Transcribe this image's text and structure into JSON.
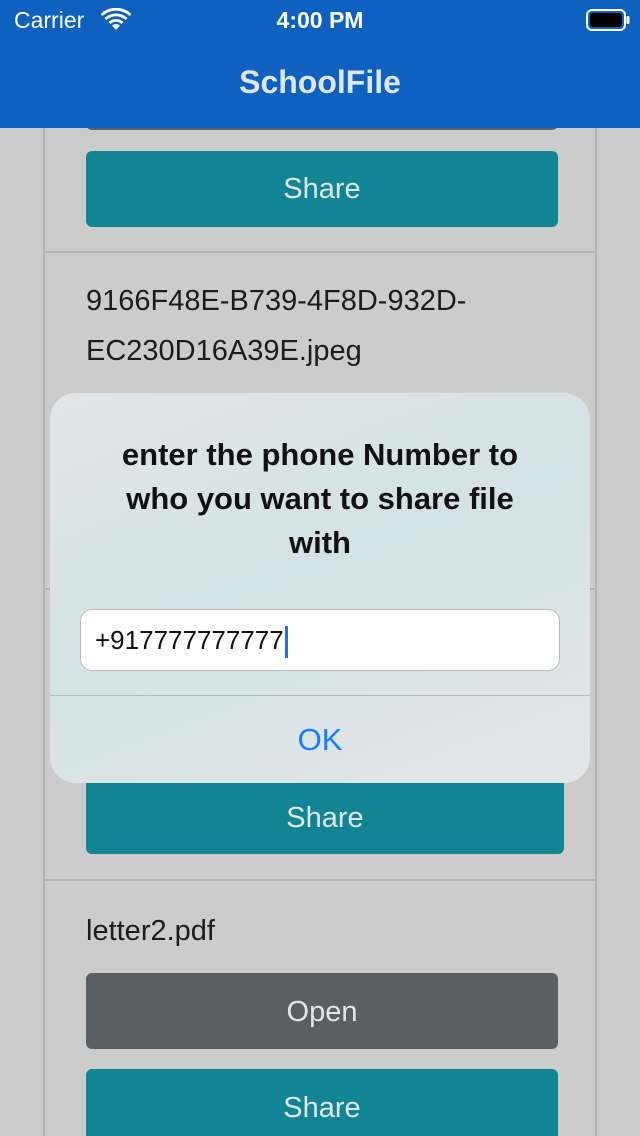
{
  "status_bar": {
    "carrier": "Carrier",
    "time": "4:00 PM"
  },
  "nav": {
    "title": "SchoolFile"
  },
  "list": {
    "items": [
      {
        "share_label": "Share"
      },
      {
        "file_name_line1": "9166F48E-B739-4F8D-932D-",
        "file_name_line2": "EC230D16A39E.jpeg"
      },
      {
        "share_label": "Share"
      },
      {
        "file_name": "letter2.pdf",
        "open_label": "Open",
        "share_label": "Share"
      }
    ]
  },
  "alert": {
    "title_line1": "enter the phone Number to",
    "title_line2": "who you want to share file",
    "title_line3": "with",
    "input_value": "+917777777777",
    "ok_label": "OK"
  },
  "colors": {
    "nav_bar": "#0e61bf",
    "share_button": "#118593",
    "open_button": "#5a5f64",
    "alert_action": "#147efb"
  },
  "icons": [
    "wifi-icon",
    "battery-icon"
  ]
}
